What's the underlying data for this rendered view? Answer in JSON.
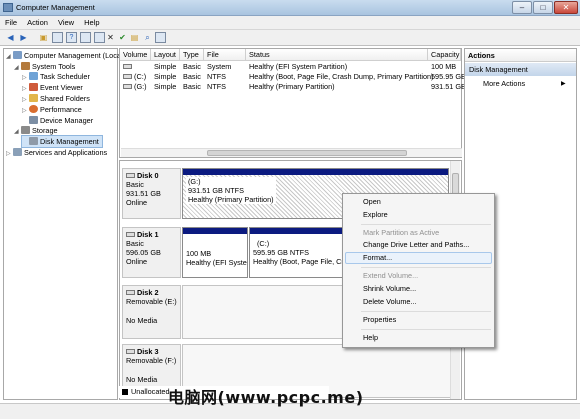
{
  "window": {
    "title": "Computer Management",
    "buttons": {
      "minimize": "–",
      "maximize": "□",
      "close": "✕"
    }
  },
  "menu": [
    "File",
    "Action",
    "View",
    "Help"
  ],
  "toolbar_icons": [
    "back-arrow",
    "forward-arrow",
    "up-folder",
    "show-hide-tree",
    "help",
    "properties",
    "close-x",
    "check",
    "open",
    "search",
    "mmc-window"
  ],
  "tree": {
    "root": "Computer Management (Local",
    "items": [
      {
        "label": "System Tools",
        "indent": 1,
        "expander": "◢"
      },
      {
        "label": "Task Scheduler",
        "indent": 2,
        "expander": "▷"
      },
      {
        "label": "Event Viewer",
        "indent": 2,
        "expander": "▷"
      },
      {
        "label": "Shared Folders",
        "indent": 2,
        "expander": "▷"
      },
      {
        "label": "Performance",
        "indent": 2,
        "expander": "▷"
      },
      {
        "label": "Device Manager",
        "indent": 2,
        "expander": ""
      },
      {
        "label": "Storage",
        "indent": 1,
        "expander": "◢"
      },
      {
        "label": "Disk Management",
        "indent": 2,
        "expander": "",
        "selected": true
      },
      {
        "label": "Services and Applications",
        "indent": 1,
        "expander": "▷"
      }
    ]
  },
  "volume_table": {
    "columns": [
      "Volume",
      "Layout",
      "Type",
      "File System",
      "Status",
      "Capacity"
    ],
    "rows": [
      {
        "volume": "",
        "layout": "Simple",
        "type": "Basic",
        "fs": "",
        "status": "Healthy (EFI System Partition)",
        "capacity": "100 MB"
      },
      {
        "volume": "(C:)",
        "layout": "Simple",
        "type": "Basic",
        "fs": "NTFS",
        "status": "Healthy (Boot, Page File, Crash Dump, Primary Partition)",
        "capacity": "595.95 GB"
      },
      {
        "volume": "(G:)",
        "layout": "Simple",
        "type": "Basic",
        "fs": "NTFS",
        "status": "Healthy (Primary Partition)",
        "capacity": "931.51 GB"
      }
    ]
  },
  "disks": [
    {
      "name": "Disk 0",
      "type": "Basic",
      "size": "931.51 GB",
      "state": "Online",
      "partitions": [
        {
          "label": "(G:)",
          "size": "931.51 GB NTFS",
          "status": "Healthy (Primary Partition)"
        }
      ]
    },
    {
      "name": "Disk 1",
      "type": "Basic",
      "size": "596.05 GB",
      "state": "Online",
      "partitions": [
        {
          "label": "",
          "size": "100 MB",
          "status": "Healthy (EFI Syster"
        },
        {
          "label": "(C:)",
          "size": "595.95 GB NTFS",
          "status": "Healthy (Boot, Page File, Cra"
        }
      ]
    },
    {
      "name": "Disk 2",
      "type": "Removable (E:)",
      "media": "No Media"
    },
    {
      "name": "Disk 3",
      "type": "Removable (F:)",
      "media": "No Media"
    }
  ],
  "legend": {
    "unallocated": "Unallocated"
  },
  "actions": {
    "header": "Actions",
    "section": "Disk Management",
    "more": "More Actions"
  },
  "context_menu": {
    "items": [
      {
        "label": "Open",
        "disabled": false
      },
      {
        "label": "Explore",
        "disabled": false
      },
      {
        "label": "Mark Partition as Active",
        "disabled": true
      },
      {
        "label": "Change Drive Letter and Paths...",
        "disabled": false
      },
      {
        "label": "Format...",
        "disabled": false,
        "highlighted": true
      },
      {
        "label": "Extend Volume...",
        "disabled": true
      },
      {
        "label": "Shrink Volume...",
        "disabled": false
      },
      {
        "label": "Delete Volume...",
        "disabled": false
      },
      {
        "label": "Properties",
        "disabled": false
      },
      {
        "label": "Help",
        "disabled": false
      }
    ]
  },
  "watermark": "电脑网(www.pcpc.me)",
  "colors": {
    "partition_bar": "#0b1a80",
    "selection": "#cfe3f7"
  }
}
